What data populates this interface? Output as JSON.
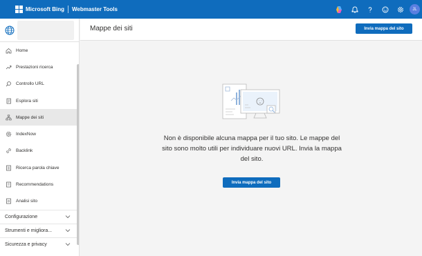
{
  "topbar": {
    "brand": "Microsoft Bing",
    "product": "Webmaster Tools",
    "avatar_initials": "JL",
    "icons": [
      "copilot-icon",
      "bell-icon",
      "help-icon",
      "smiley-icon",
      "gear-icon"
    ]
  },
  "sidebar": {
    "items": [
      {
        "label": "Home",
        "icon": "home-icon"
      },
      {
        "label": "Prestazioni ricerca",
        "icon": "trend-icon"
      },
      {
        "label": "Controllo URL",
        "icon": "search-icon"
      },
      {
        "label": "Esplora siti",
        "icon": "document-icon"
      },
      {
        "label": "Mappe dei siti",
        "icon": "sitemap-icon",
        "active": true
      },
      {
        "label": "IndexNow",
        "icon": "gear-icon"
      },
      {
        "label": "Backlink",
        "icon": "link-icon"
      },
      {
        "label": "Ricerca parola chiave",
        "icon": "keyword-icon"
      },
      {
        "label": "Recommendations",
        "icon": "list-icon"
      },
      {
        "label": "Analisi sito",
        "icon": "analysis-icon"
      }
    ],
    "groups": [
      {
        "label": "Configurazione"
      },
      {
        "label": "Strumenti e migliora..."
      },
      {
        "label": "Sicurezza e privacy"
      }
    ]
  },
  "main": {
    "title": "Mappe dei siti",
    "header_button": "Invia mappa del sito",
    "empty_message": "Non è disponibile alcuna mappa per il tuo sito. Le mappe del sito sono molto utili per individuare nuovi URL. Invia la mappa del sito.",
    "cta_button": "Invia mappa del sito"
  },
  "colors": {
    "accent": "#0f6cbd",
    "active_nav": "#e8e8e8"
  }
}
